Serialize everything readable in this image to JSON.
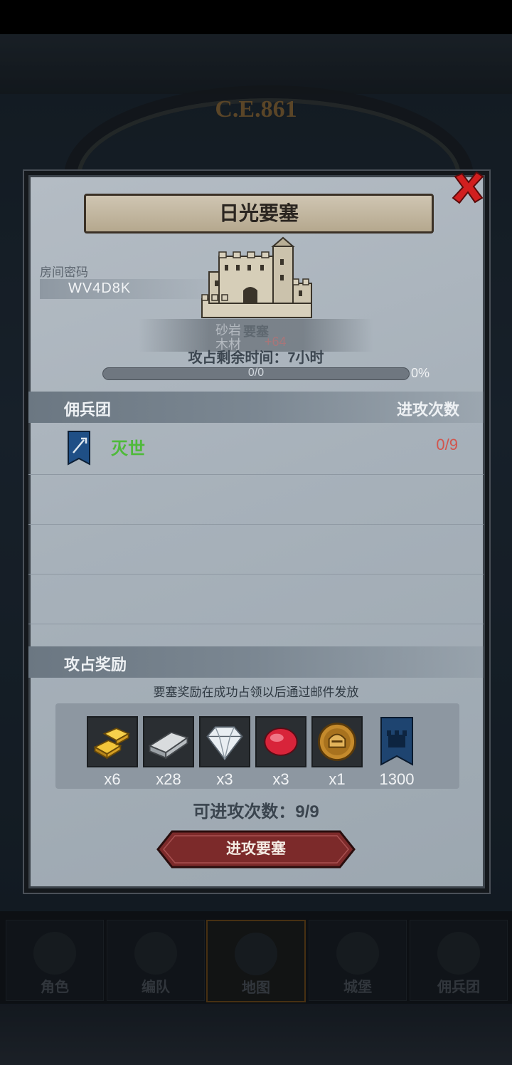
{
  "background": {
    "year_label": "C.E.861",
    "nav": [
      {
        "label": "角色"
      },
      {
        "label": "编队"
      },
      {
        "label": "地图"
      },
      {
        "label": "城堡"
      },
      {
        "label": "佣兵团"
      }
    ]
  },
  "dialog": {
    "title": "日光要塞",
    "room_label": "房间密码",
    "room_code": "WV4D8K",
    "fortress_type": "要塞",
    "faded_labels": [
      "砂岩",
      "木材"
    ],
    "faded_value": "+64",
    "remaining_time": "攻占剩余时间：7小时",
    "progress": {
      "count": "0/0",
      "percent": "0%",
      "fill_fraction": 0
    },
    "mercenary_header": {
      "left": "佣兵团",
      "right": "进攻次数"
    },
    "mercenaries": [
      {
        "name": "灭世",
        "attacks": "0/9"
      }
    ],
    "rewards_header": "攻占奖励",
    "rewards_note": "要塞奖励在成功占领以后通过邮件发放",
    "rewards": [
      {
        "icon": "gold-bar-icon",
        "qty": "x6"
      },
      {
        "icon": "iron-bar-icon",
        "qty": "x28"
      },
      {
        "icon": "diamond-icon",
        "qty": "x3"
      },
      {
        "icon": "ruby-icon",
        "qty": "x3"
      },
      {
        "icon": "helmet-medal-icon",
        "qty": "x1"
      },
      {
        "icon": "banner-icon",
        "qty": "1300"
      }
    ],
    "available_attacks": "可进攻次数：9/9",
    "attack_button": "进攻要塞"
  },
  "colors": {
    "panel": "#a7b1ba",
    "mercenary_name": "#4fba3a",
    "attack_count": "#d2554d",
    "close_x": "#d11f1f",
    "button": "#7c2a2a"
  }
}
